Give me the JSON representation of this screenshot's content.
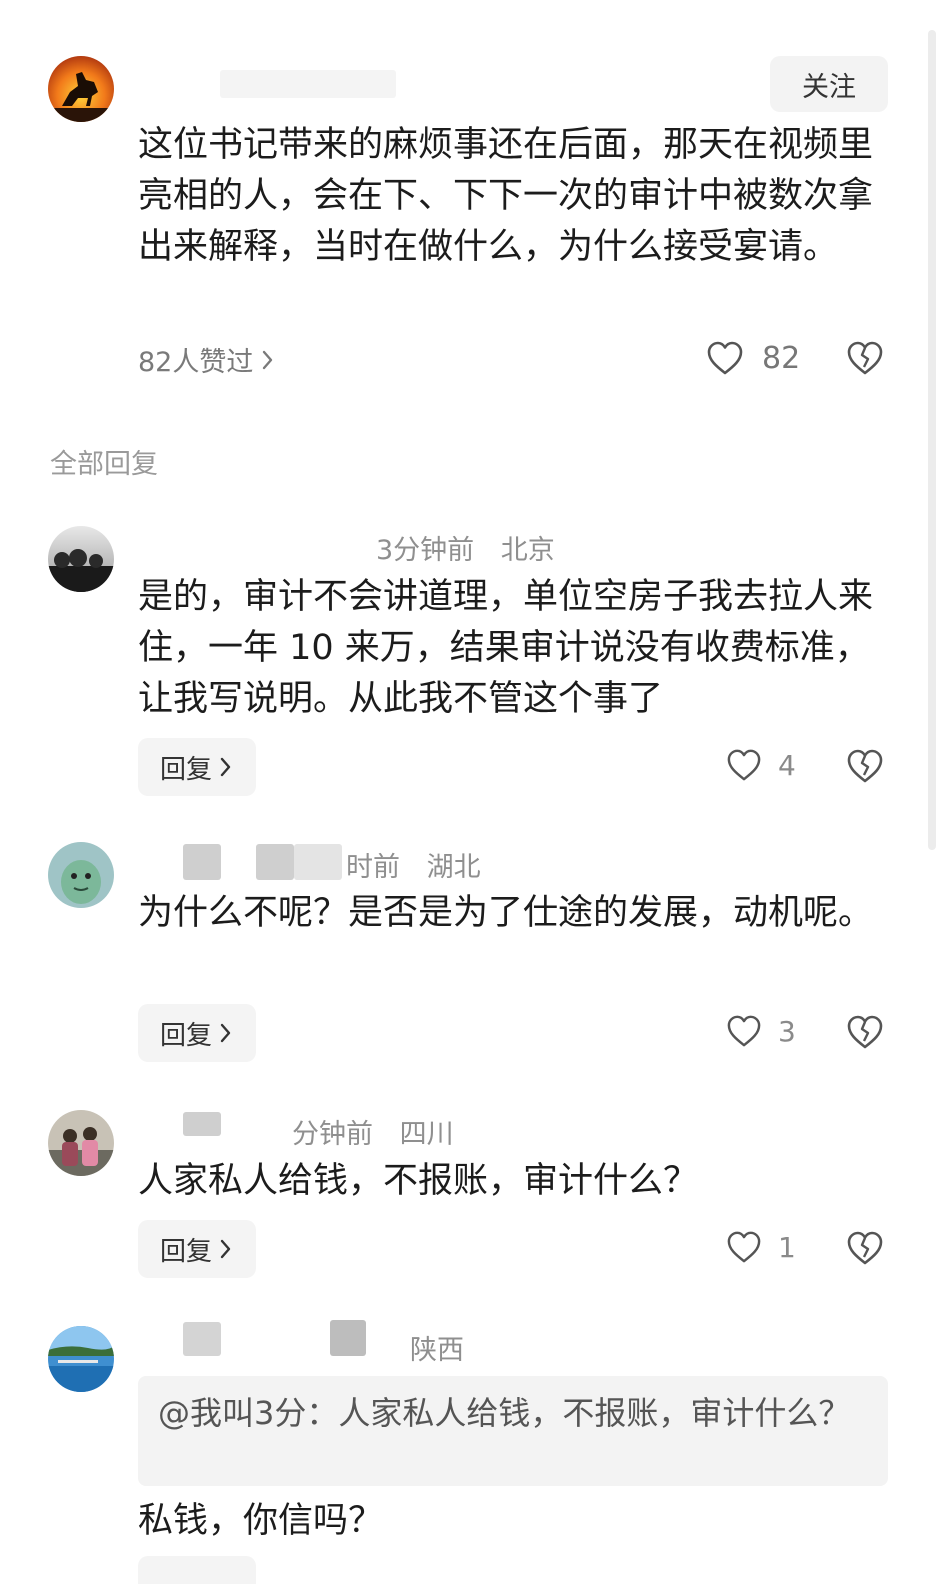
{
  "main_comment": {
    "text": "这位书记带来的麻烦事还在后面，那天在视频里亮相的人，会在下、下下一次的审计中被数次拿出来解释，当时在做什么，为什么接受宴请。",
    "follow_label": "关注",
    "likers_summary": "82人赞过",
    "like_count": "82"
  },
  "replies_section": {
    "title": "全部回复"
  },
  "replies": [
    {
      "meta_time": "3分钟前",
      "meta_location": "北京",
      "text": "是的，审计不会讲道理，单位空房子我去拉人来住，一年 10 来万，结果审计说没有收费标准，让我写说明。从此我不管这个事了",
      "reply_label": "回复",
      "like_count": "4"
    },
    {
      "meta_time": "时前",
      "meta_location": "湖北",
      "text": "为什么不呢？是否是为了仕途的发展，动机呢。",
      "reply_label": "回复",
      "like_count": "3"
    },
    {
      "meta_time": "分钟前",
      "meta_location": "四川",
      "text": "人家私人给钱，不报账，审计什么？",
      "reply_label": "回复",
      "like_count": "1"
    },
    {
      "meta_location": "陕西",
      "quote": "@我叫3分：人家私人给钱，不报账，审计什么？",
      "text": "私钱，你信吗？"
    }
  ],
  "icons": {
    "like": "heart-outline-icon",
    "dislike": "broken-heart-icon",
    "chevron": "chevron-right-icon"
  },
  "colors": {
    "text_primary": "#1c1c1c",
    "text_secondary": "#8f8f8f",
    "button_bg": "#f3f3f3"
  }
}
